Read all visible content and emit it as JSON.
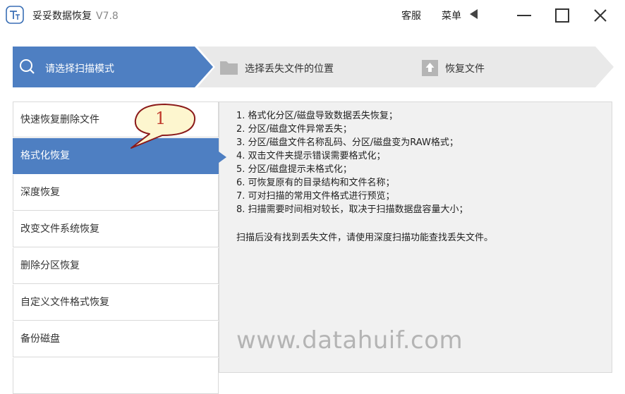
{
  "titlebar": {
    "app_name": "妥妥数据恢复",
    "version": "V7.8",
    "service": "客服",
    "menu": "菜单"
  },
  "steps": [
    {
      "label": "请选择扫描模式",
      "icon": "search-icon",
      "active": true
    },
    {
      "label": "选择丢失文件的位置",
      "icon": "folder-icon",
      "active": false
    },
    {
      "label": "恢复文件",
      "icon": "restore-icon",
      "active": false
    }
  ],
  "menu_items": [
    {
      "label": "快速恢复删除文件"
    },
    {
      "label": "格式化恢复"
    },
    {
      "label": "深度恢复"
    },
    {
      "label": "改变文件系统恢复"
    },
    {
      "label": "删除分区恢复"
    },
    {
      "label": "自定义文件格式恢复"
    },
    {
      "label": "备份磁盘"
    }
  ],
  "selected_menu": "格式化恢复",
  "panel": {
    "lines": [
      "1. 格式化分区/磁盘导致数据丢失恢复；",
      "2. 分区/磁盘文件异常丢失；",
      "3. 分区/磁盘文件名称乱码、分区/磁盘变为RAW格式；",
      "4. 双击文件夹提示错误需要格式化；",
      "5. 分区/磁盘提示未格式化；",
      "6. 可恢复原有的目录结构和文件名称；",
      "7. 可对扫描的常用文件格式进行预览；",
      "8. 扫描需要时间相对较长，取决于扫描数据盘容量大小；"
    ],
    "note": "扫描后没有找到丢失文件，请使用深度扫描功能查找丢失文件。",
    "watermark": "www.datahuif.com"
  },
  "callout": {
    "number": "1"
  },
  "colors": {
    "accent": "#4e7fc2",
    "step_inactive": "#e9e9e9",
    "callout_fill": "#fdf6cf",
    "callout_border": "#8b1a1a"
  }
}
